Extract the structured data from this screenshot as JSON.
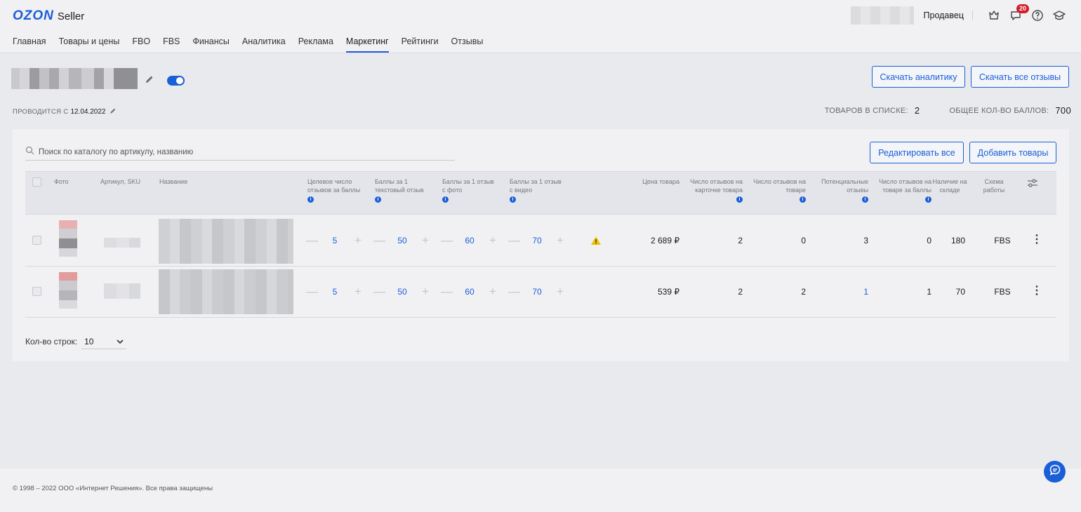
{
  "header": {
    "logo_brand": "OZON",
    "logo_suffix": "Seller",
    "seller_label": "Продавец",
    "notifications_count": "20",
    "nav": [
      "Главная",
      "Товары и цены",
      "FBO",
      "FBS",
      "Финансы",
      "Аналитика",
      "Реклама",
      "Маркетинг",
      "Рейтинги",
      "Отзывы"
    ],
    "active_nav": "Маркетинг"
  },
  "page": {
    "download_analytics": "Скачать аналитику",
    "download_reviews": "Скачать все отзывы",
    "runs_since_label": "ПРОВОДИТСЯ С",
    "runs_since_date": "12.04.2022",
    "items_in_list_label": "ТОВАРОВ В СПИСКЕ:",
    "items_in_list_value": "2",
    "total_points_label": "ОБЩЕЕ КОЛ-ВО БАЛЛОВ:",
    "total_points_value": "700",
    "toggle_on": true
  },
  "panel": {
    "search_placeholder": "Поиск по каталогу по артикулу, названию",
    "edit_all": "Редактировать все",
    "add_items": "Добавить товары",
    "columns": {
      "photo": "Фото",
      "sku": "Артикул, SKU",
      "name": "Название",
      "target": "Целевое число отзывов за баллы",
      "text_points": "Баллы за 1 текстовый отзыв",
      "photo_points": "Баллы за 1 отзыв с фото",
      "video_points": "Баллы за 1 отзыв с видео",
      "price": "Цена товара",
      "card_reviews": "Число отзывов на карточке товара",
      "item_reviews": "Число отзывов на товаре",
      "potential": "Потенциальные отзывы",
      "paid_reviews": "Число отзывов на товаре за баллы",
      "stock": "Наличие на складе",
      "scheme": "Схема работы"
    },
    "rows": [
      {
        "target": "5",
        "text_points": "50",
        "photo_points": "60",
        "video_points": "70",
        "warning": true,
        "price": "2 689 ₽",
        "card_reviews": "2",
        "item_reviews": "0",
        "potential": "3",
        "paid_reviews": "0",
        "stock": "180",
        "scheme": "FBS"
      },
      {
        "target": "5",
        "text_points": "50",
        "photo_points": "60",
        "video_points": "70",
        "warning": false,
        "price": "539 ₽",
        "card_reviews": "2",
        "item_reviews": "2",
        "potential": "1",
        "paid_reviews": "1",
        "stock": "70",
        "scheme": "FBS"
      }
    ],
    "rows_per_page_label": "Кол-во строк:",
    "rows_per_page_value": "10"
  },
  "footer": {
    "copyright": "© 1998 – 2022 ООО «Интернет Решения». Все права защищены"
  },
  "colors": {
    "accent": "#1a5fd8",
    "badge": "#d41c2b",
    "warning": "#f2c200"
  }
}
